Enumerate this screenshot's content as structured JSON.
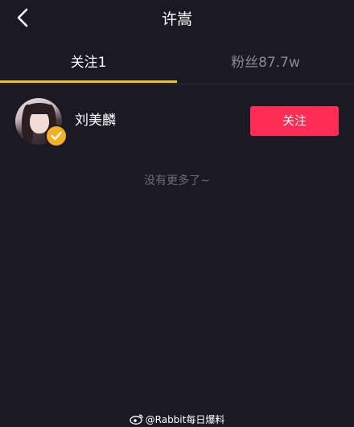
{
  "header": {
    "title": "许嵩",
    "back_icon": "chevron-left-icon"
  },
  "tabs": [
    {
      "label": "关注1",
      "active": true
    },
    {
      "label": "粉丝87.7w",
      "active": false
    }
  ],
  "colors": {
    "background": "#1a1924",
    "tab_indicator": "#f0c02a",
    "follow_button": "#fe2c55",
    "verified_badge": "#f4b023",
    "muted_text": "#6d6c78"
  },
  "following_list": [
    {
      "name": "刘美麟",
      "verified": true,
      "action_label": "关注"
    }
  ],
  "footer_message": "没有更多了~",
  "watermark": {
    "icon": "weibo-icon",
    "text": "@Rabbit每日爆料"
  }
}
